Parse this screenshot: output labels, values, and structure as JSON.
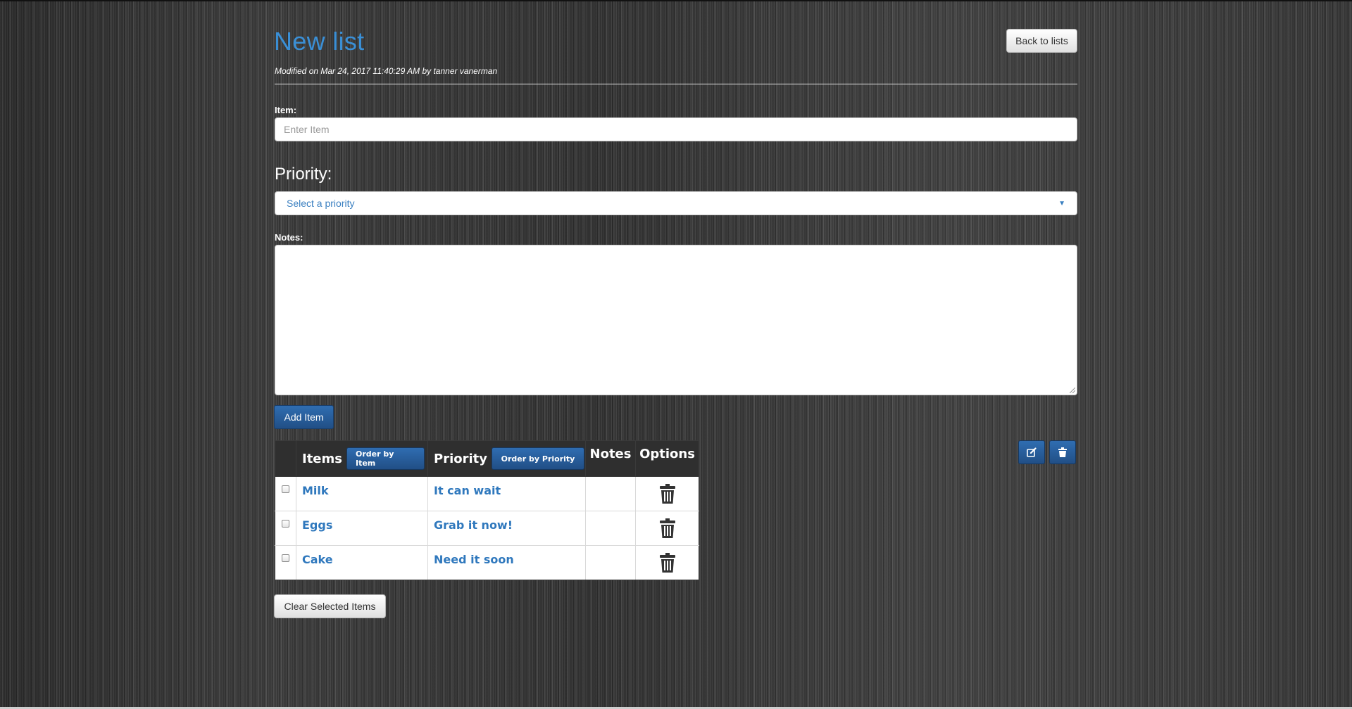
{
  "header": {
    "title": "New list",
    "modified": "Modified on Mar 24, 2017 11:40:29 AM by tanner vanerman",
    "back_label": "Back to lists"
  },
  "form": {
    "item_label": "Item:",
    "item_placeholder": "Enter Item",
    "priority_label": "Priority:",
    "priority_selected": "Select a priority",
    "notes_label": "Notes:",
    "add_label": "Add Item"
  },
  "table": {
    "headers": {
      "items": "Items",
      "order_by_item": "Order by Item",
      "priority": "Priority",
      "order_by_priority": "Order by Priority",
      "notes": "Notes",
      "options": "Options"
    },
    "rows": [
      {
        "item": "Milk",
        "priority": "It can wait",
        "notes": ""
      },
      {
        "item": "Eggs",
        "priority": "Grab it now!",
        "notes": ""
      },
      {
        "item": "Cake",
        "priority": "Need it soon",
        "notes": ""
      }
    ]
  },
  "toolbar": {
    "edit_icon": "edit-icon",
    "delete_icon": "trash-icon"
  },
  "clear_label": "Clear Selected Items",
  "colors": {
    "accent": "#2f6db1",
    "title": "#3a8fd6",
    "link": "#2f78bd"
  }
}
